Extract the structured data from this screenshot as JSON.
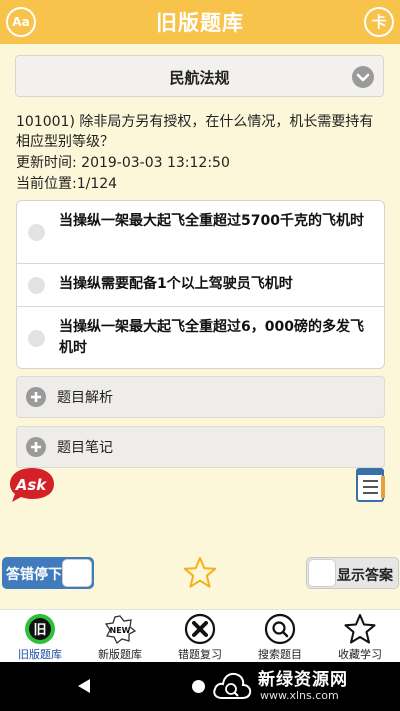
{
  "header": {
    "title": "旧版题库",
    "left_icon_text": "Aa",
    "right_icon_text": "卡"
  },
  "category": {
    "label": "民航法规",
    "icon": "chevron-down-icon"
  },
  "question": {
    "text": "101001) 除非局方另有授权，在什么情况，机长需要持有相应型别等级？",
    "updated": "更新时间: 2019-03-03 13:12:50",
    "position": "当前位置:1/124"
  },
  "options": [
    {
      "text": "当操纵一架最大起飞全重超过5700千克的飞机时"
    },
    {
      "text": "当操纵需要配备1个以上驾驶员飞机时"
    },
    {
      "text": "当操纵一架最大起飞全重超过6，000磅的多发飞机时"
    }
  ],
  "panels": {
    "analysis": "题目解析",
    "notes": "题目笔记"
  },
  "ask_logo_text": "Ask",
  "controls": {
    "stop_on_wrong": "答错停下",
    "show_answer": "显示答案"
  },
  "tabs": [
    {
      "label": "旧版题库",
      "icon": "old-bank-icon",
      "icon_text": "旧"
    },
    {
      "label": "新版题库",
      "icon": "new-badge-icon",
      "icon_text": "NEW"
    },
    {
      "label": "错题复习",
      "icon": "close-circle-icon"
    },
    {
      "label": "搜索题目",
      "icon": "search-icon"
    },
    {
      "label": "收藏学习",
      "icon": "star-icon"
    }
  ],
  "watermark": {
    "title": "新绿资源网",
    "url": "www.xlns.com"
  },
  "colors": {
    "header": "#f7c34a",
    "background": "#fdf7d9",
    "toggle_on": "#3f7bbd",
    "active_tab": "#1a4fa3",
    "star": "#f2b21b"
  }
}
